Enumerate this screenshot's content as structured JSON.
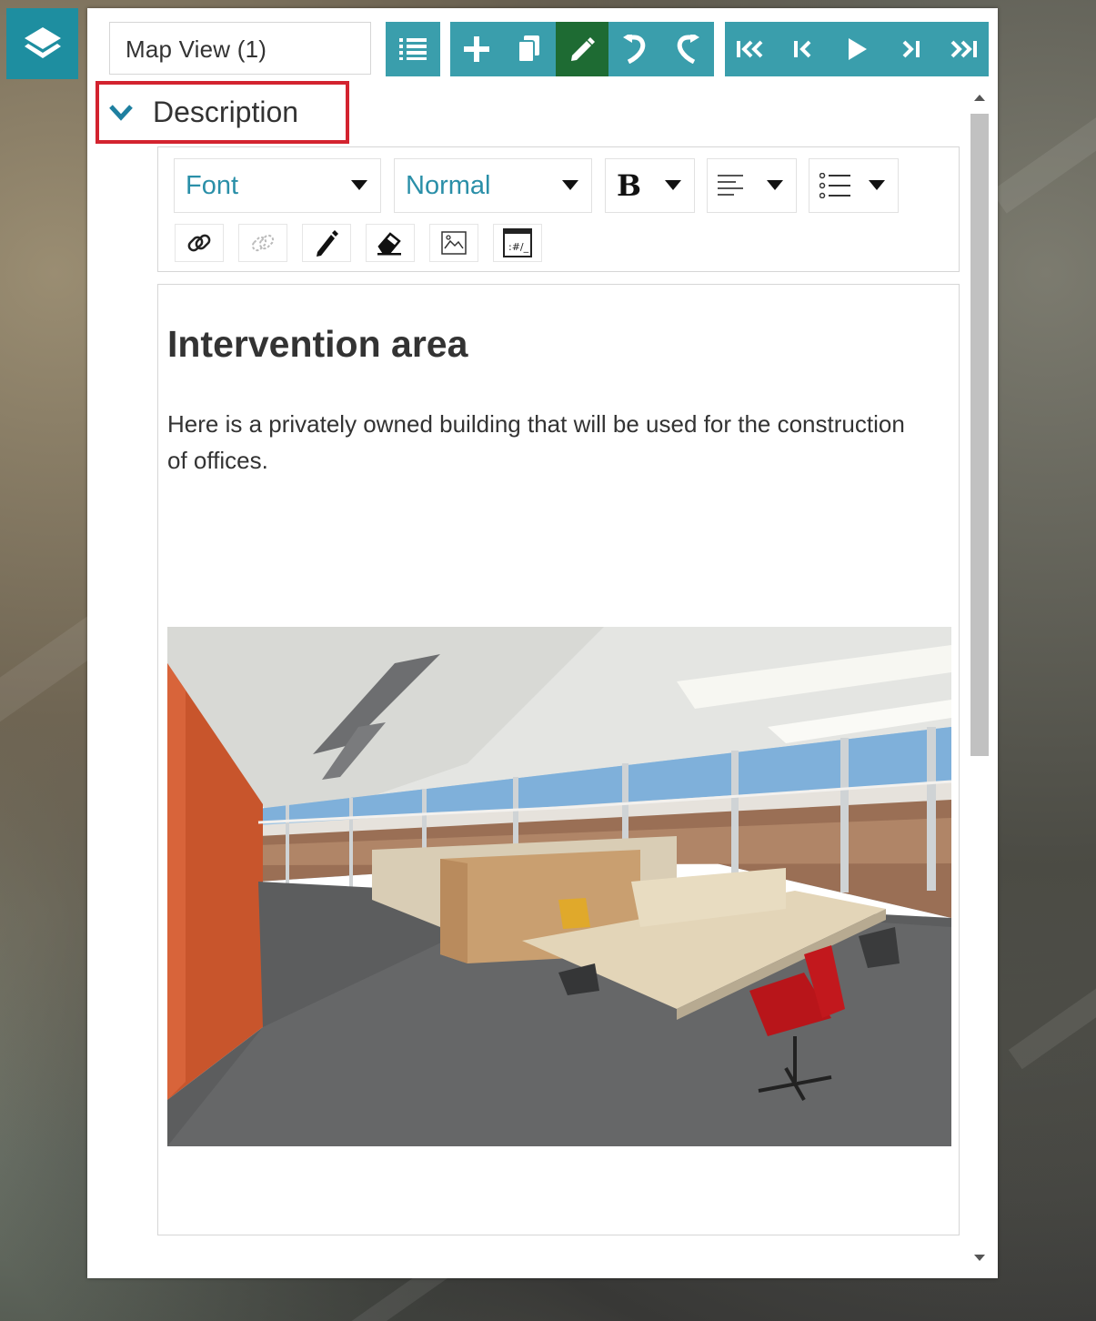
{
  "panel": {
    "view_title": "Map View (1)",
    "section_title": "Description",
    "toolbar_groups": [
      {
        "name": "list",
        "buttons": [
          "list-icon"
        ]
      },
      {
        "name": "edit",
        "buttons": [
          "plus-icon",
          "copy-icon",
          "pencil-icon",
          "undo-icon",
          "redo-icon"
        ],
        "active": "pencil-icon"
      },
      {
        "name": "playback",
        "buttons": [
          "first-icon",
          "previous-icon",
          "play-icon",
          "next-icon",
          "last-icon"
        ]
      }
    ]
  },
  "editor": {
    "font_dropdown": "Font",
    "size_dropdown": "Normal",
    "bold_label": "B",
    "tools": [
      "link-icon",
      "unlink-icon",
      "pen-icon",
      "eraser-icon",
      "image-icon",
      "source-icon"
    ]
  },
  "content": {
    "heading": "Intervention area",
    "paragraph": "Here is a privately owned building that will be used for the construction of offices."
  },
  "colors": {
    "accent": "#3a9eac",
    "accent_dark": "#1e8ea0",
    "active": "#1e6b33",
    "highlight_border": "#d3232f",
    "link_text": "#2a8fa8"
  }
}
